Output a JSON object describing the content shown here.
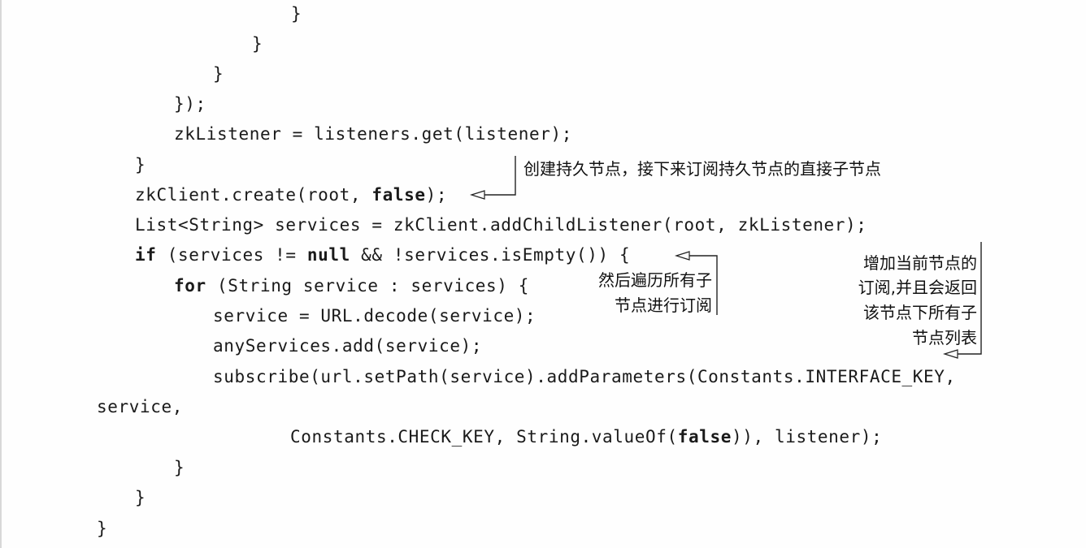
{
  "code": {
    "l1": "}",
    "l2": "}",
    "l3": "}",
    "l4": "});",
    "l5": "zkListener = listeners.get(listener);",
    "l6": "}",
    "l7_a": "zkClient.create(root, ",
    "l7_kw": "false",
    "l7_b": ");",
    "l8": "List<String> services = zkClient.addChildListener(root, zkListener);",
    "l9_kw1": "if",
    "l9_a": " (services != ",
    "l9_kw2": "null",
    "l9_b": " && !services.isEmpty()) {",
    "l10_kw": "for",
    "l10_a": " (String service : services) {",
    "l11": "service = URL.decode(service);",
    "l12": "anyServices.add(service);",
    "l13": "subscribe(url.setPath(service).addParameters(Constants.INTERFACE_KEY,",
    "l14": "service,",
    "l15_a": "Constants.CHECK_KEY, String.valueOf(",
    "l15_kw": "false",
    "l15_b": ")), listener);",
    "l16": "}",
    "l17": "}",
    "l18": "}"
  },
  "annotations": {
    "create_note": "创建持久节点，接下来订阅持久节点的直接子节点",
    "iterate_note_1": "然后遍历所有子",
    "iterate_note_2": "节点进行订阅",
    "subscribe_note_1": "增加当前节点的",
    "subscribe_note_2": "订阅,并且会返回",
    "subscribe_note_3": "该节点下所有子",
    "subscribe_note_4": "节点列表"
  }
}
